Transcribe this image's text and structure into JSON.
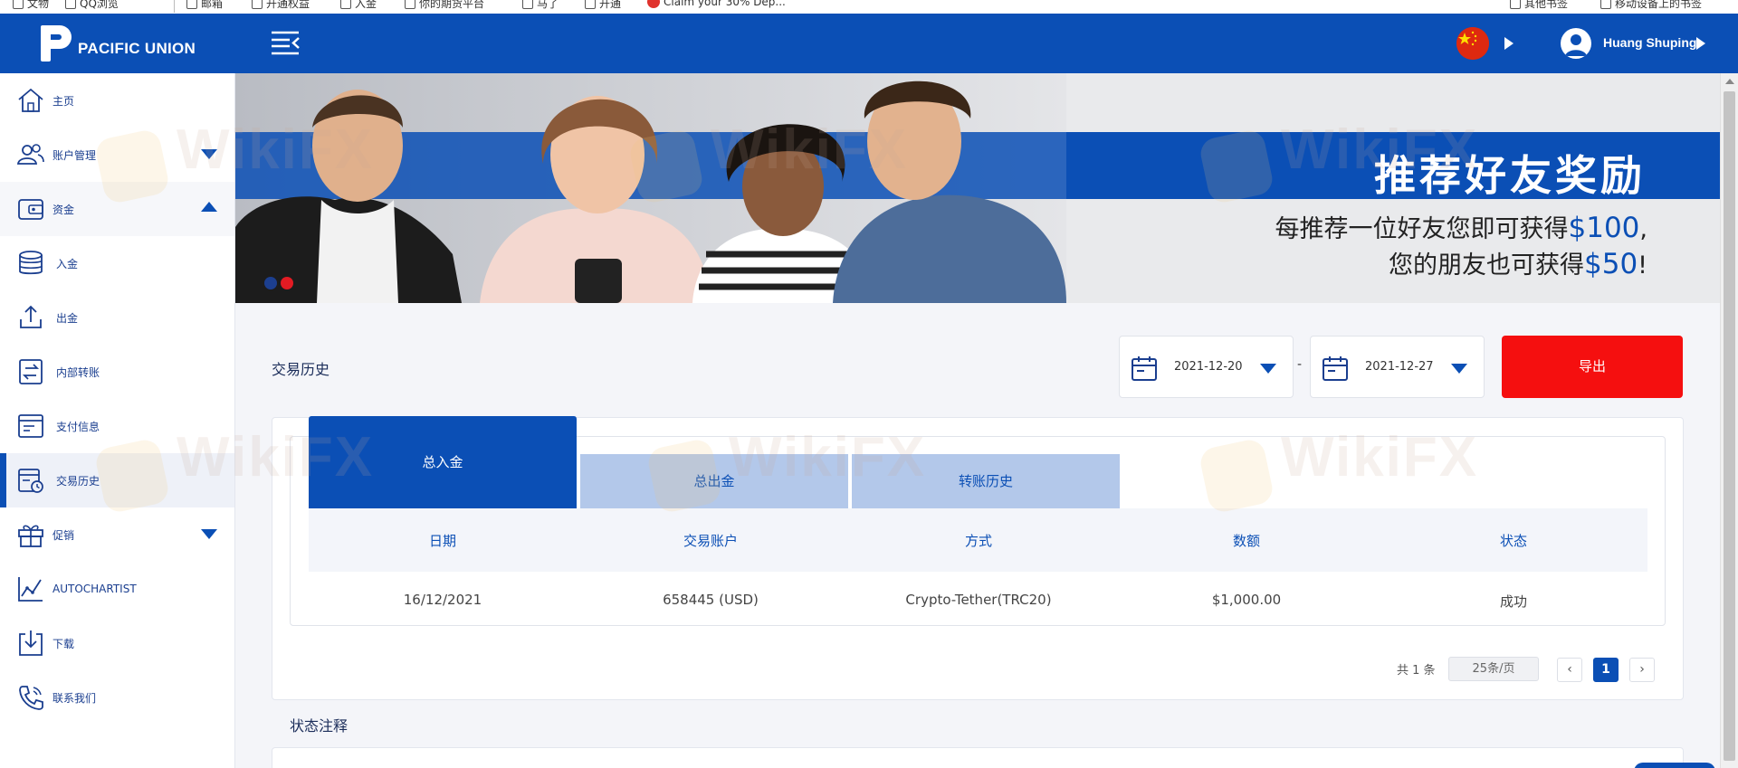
{
  "browser": {
    "bookmarks": [
      "文物",
      "QQ浏览",
      "邮箱",
      "开通权益",
      "入金",
      "你的期货平台",
      "马了",
      "开通",
      "Claim your 30% Dep..."
    ],
    "bookmarks_right": [
      "其他书签",
      "移动设备上的书签"
    ]
  },
  "header": {
    "brand": "PACIFIC UNION",
    "user_name": "Huang Shuping"
  },
  "sidebar": {
    "items": [
      {
        "label": "主页",
        "icon": "home-icon"
      },
      {
        "label": "账户管理",
        "icon": "users-icon"
      },
      {
        "label": "资金",
        "icon": "wallet-icon"
      },
      {
        "label": "入金",
        "icon": "deposit-icon"
      },
      {
        "label": "出金",
        "icon": "withdraw-icon"
      },
      {
        "label": "内部转账",
        "icon": "transfer-icon"
      },
      {
        "label": "支付信息",
        "icon": "payment-info-icon"
      },
      {
        "label": "交易历史",
        "icon": "history-icon"
      },
      {
        "label": "促销",
        "icon": "gift-icon"
      },
      {
        "label": "AUTOCHARTIST",
        "icon": "chart-icon"
      },
      {
        "label": "下载",
        "icon": "download-icon"
      },
      {
        "label": "联系我们",
        "icon": "phone-icon"
      }
    ]
  },
  "banner": {
    "title": "推荐好友奖励",
    "line1_prefix": "每推荐一位好友您即可获得",
    "line1_amount": "$100",
    "line1_suffix": ",",
    "line2_prefix": "您的朋友也可获得",
    "line2_amount": "$50",
    "line2_suffix": "!",
    "colors": {
      "accent": "#0b4fb5",
      "dot_active": "#e31b23",
      "dot_inactive": "#1c3f8f"
    }
  },
  "page": {
    "title": "交易历史",
    "date_from": "2021-12-20",
    "date_separator": "-",
    "date_to": "2021-12-27",
    "export_label": "导出",
    "export_color": "#f50f0f"
  },
  "tabs": [
    "总入金",
    "总出金",
    "转账历史"
  ],
  "table": {
    "columns": [
      "日期",
      "交易账户",
      "方式",
      "数额",
      "状态"
    ],
    "rows": [
      [
        "16/12/2021",
        "658445 (USD)",
        "Crypto-Tether(TRC20)",
        "$1,000.00",
        "成功"
      ]
    ]
  },
  "pagination": {
    "total": "共 1 条",
    "page_size": "25条/页",
    "prev": "‹",
    "current": "1",
    "next": "›"
  },
  "status_note": "状态注释",
  "watermark": "WikiFX"
}
